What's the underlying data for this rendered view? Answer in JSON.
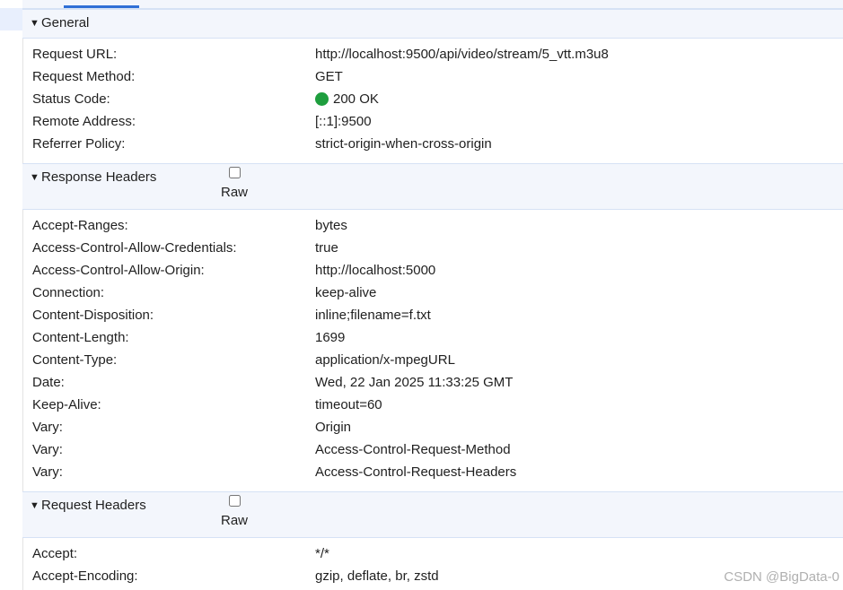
{
  "general": {
    "title": "General",
    "rows": [
      {
        "key": "Request URL:",
        "value": "http://localhost:9500/api/video/stream/5_vtt.m3u8"
      },
      {
        "key": "Request Method:",
        "value": "GET"
      },
      {
        "key": "Status Code:",
        "value": "200 OK",
        "status_color": "#1e9e3e"
      },
      {
        "key": "Remote Address:",
        "value": "[::1]:9500"
      },
      {
        "key": "Referrer Policy:",
        "value": "strict-origin-when-cross-origin"
      }
    ]
  },
  "response_headers": {
    "title": "Response Headers",
    "raw_label": "Raw",
    "raw_checked": false,
    "rows": [
      {
        "key": "Accept-Ranges:",
        "value": "bytes"
      },
      {
        "key": "Access-Control-Allow-Credentials:",
        "value": "true"
      },
      {
        "key": "Access-Control-Allow-Origin:",
        "value": "http://localhost:5000"
      },
      {
        "key": "Connection:",
        "value": "keep-alive"
      },
      {
        "key": "Content-Disposition:",
        "value": "inline;filename=f.txt"
      },
      {
        "key": "Content-Length:",
        "value": "1699"
      },
      {
        "key": "Content-Type:",
        "value": "application/x-mpegURL"
      },
      {
        "key": "Date:",
        "value": "Wed, 22 Jan 2025 11:33:25 GMT"
      },
      {
        "key": "Keep-Alive:",
        "value": "timeout=60"
      },
      {
        "key": "Vary:",
        "value": "Origin"
      },
      {
        "key": "Vary:",
        "value": "Access-Control-Request-Method"
      },
      {
        "key": "Vary:",
        "value": "Access-Control-Request-Headers"
      }
    ]
  },
  "request_headers": {
    "title": "Request Headers",
    "raw_label": "Raw",
    "raw_checked": false,
    "rows": [
      {
        "key": "Accept:",
        "value": "*/*"
      },
      {
        "key": "Accept-Encoding:",
        "value": "gzip, deflate, br, zstd"
      }
    ]
  },
  "icons": {
    "section_toggle": "triangle-down-icon",
    "status": "status-dot-icon"
  },
  "watermark": "CSDN @BigData-0"
}
